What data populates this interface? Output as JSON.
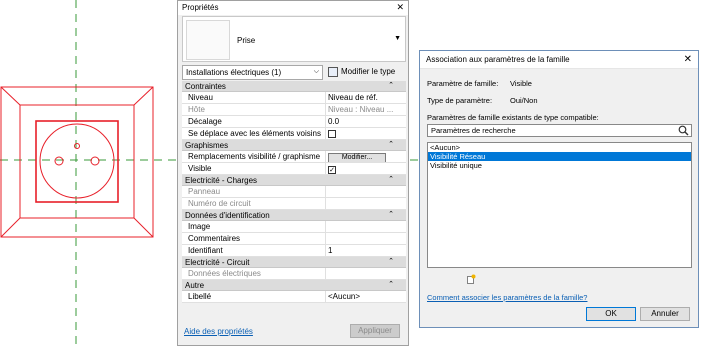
{
  "properties": {
    "title": "Propriétés",
    "close_glyph": "✕",
    "type_name": "Prise",
    "filter_value": "Installations électriques (1)",
    "edit_type_label": "Modifier le type",
    "groups": {
      "contraintes": "Contraintes",
      "graphismes": "Graphismes",
      "elec_charges": "Electricité - Charges",
      "donnees_id": "Données d'identification",
      "elec_circuit": "Electricité - Circuit",
      "autre": "Autre"
    },
    "rows": {
      "niveau_k": "Niveau",
      "niveau_v": "Niveau de réf.",
      "hote_k": "Hôte",
      "hote_v": "Niveau : Niveau ...",
      "decalage_k": "Décalage",
      "decalage_v": "0.0",
      "deplace_k": "Se déplace avec les éléments voisins",
      "remplacements_k": "Remplacements visibilité / graphisme",
      "remplacements_btn": "Modifier...",
      "visible_k": "Visible",
      "visible_check": "✓",
      "panneau_k": "Panneau",
      "numero_k": "Numéro de circuit",
      "image_k": "Image",
      "commentaires_k": "Commentaires",
      "identifiant_k": "Identifiant",
      "identifiant_v": "1",
      "donnees_elec_k": "Données électriques",
      "libelle_k": "Libellé",
      "libelle_v": "<Aucun>"
    },
    "help_link": "Aide des propriétés",
    "apply_label": "Appliquer"
  },
  "dialog": {
    "title": "Association aux paramètres de la famille",
    "close_glyph": "✕",
    "family_param_label": "Paramètre de famille:",
    "family_param_value": "Visible",
    "param_type_label": "Type de paramètre:",
    "param_type_value": "Oui/Non",
    "existing_label": "Paramètres de famille existants de type compatible:",
    "search_placeholder": "Paramètres de recherche",
    "list_items": [
      "<Aucun>",
      "Visibilité Réseau",
      "Visibilité unique"
    ],
    "selected_index": 1,
    "how_link": "Comment associer les paramètres de la famille?",
    "ok_label": "OK",
    "cancel_label": "Annuler"
  },
  "colors": {
    "drawing_red": "#e8202a",
    "centerline_green": "#3a9a3a",
    "selection_blue": "#0078d7",
    "link_blue": "#0a5fb4"
  }
}
